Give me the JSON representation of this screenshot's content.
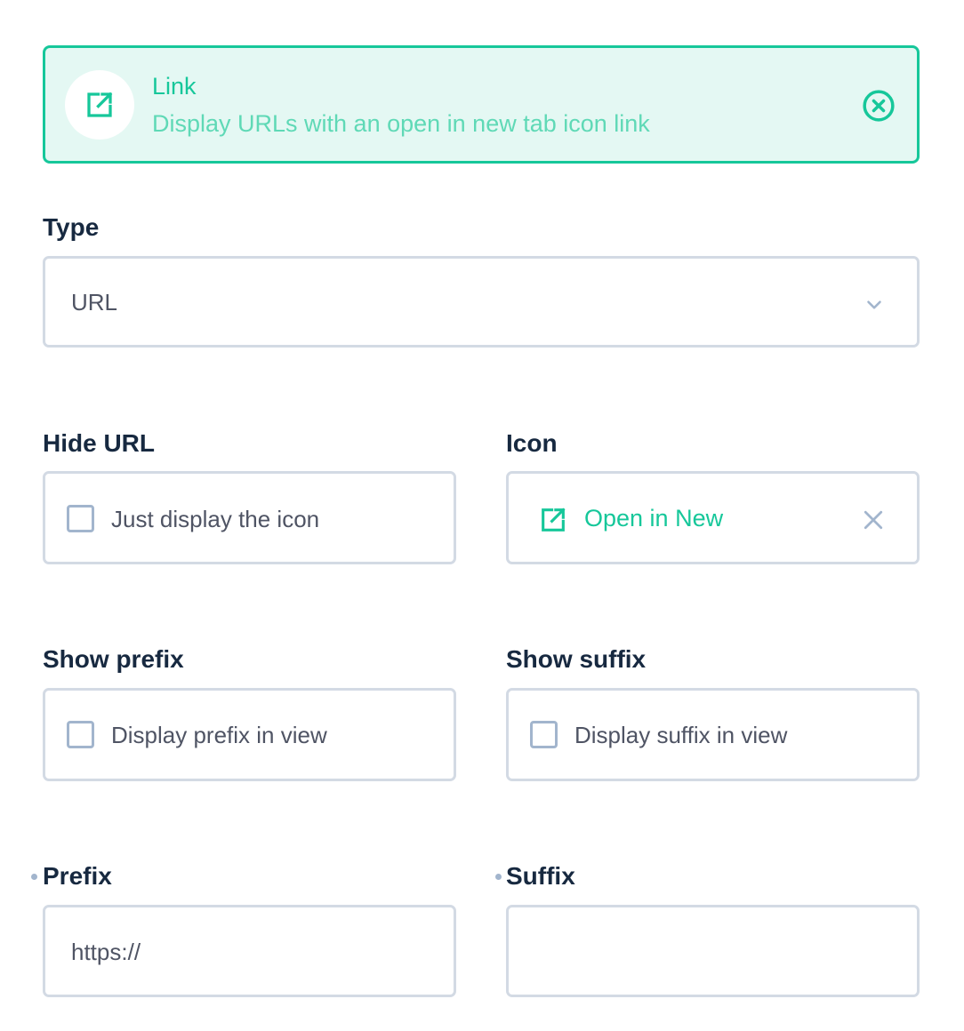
{
  "banner": {
    "title": "Link",
    "subtitle": "Display URLs with an open in new tab icon link",
    "icon": "open-in-new-icon",
    "close_icon": "close-circle-icon",
    "accent_color": "#16c79a",
    "background_color": "#e4f8f3"
  },
  "type_field": {
    "label": "Type",
    "value": "URL",
    "icon": "chevron-down-icon"
  },
  "hide_url": {
    "label": "Hide URL",
    "checkbox_label": "Just display the icon",
    "checked": false
  },
  "icon_field": {
    "label": "Icon",
    "value": "Open in New",
    "icon": "open-in-new-icon",
    "clear_icon": "close-icon"
  },
  "show_prefix": {
    "label": "Show prefix",
    "checkbox_label": "Display prefix in view",
    "checked": false
  },
  "show_suffix": {
    "label": "Show suffix",
    "checkbox_label": "Display suffix in view",
    "checked": false
  },
  "prefix": {
    "label": "Prefix",
    "value": "https://"
  },
  "suffix": {
    "label": "Suffix",
    "value": ""
  }
}
